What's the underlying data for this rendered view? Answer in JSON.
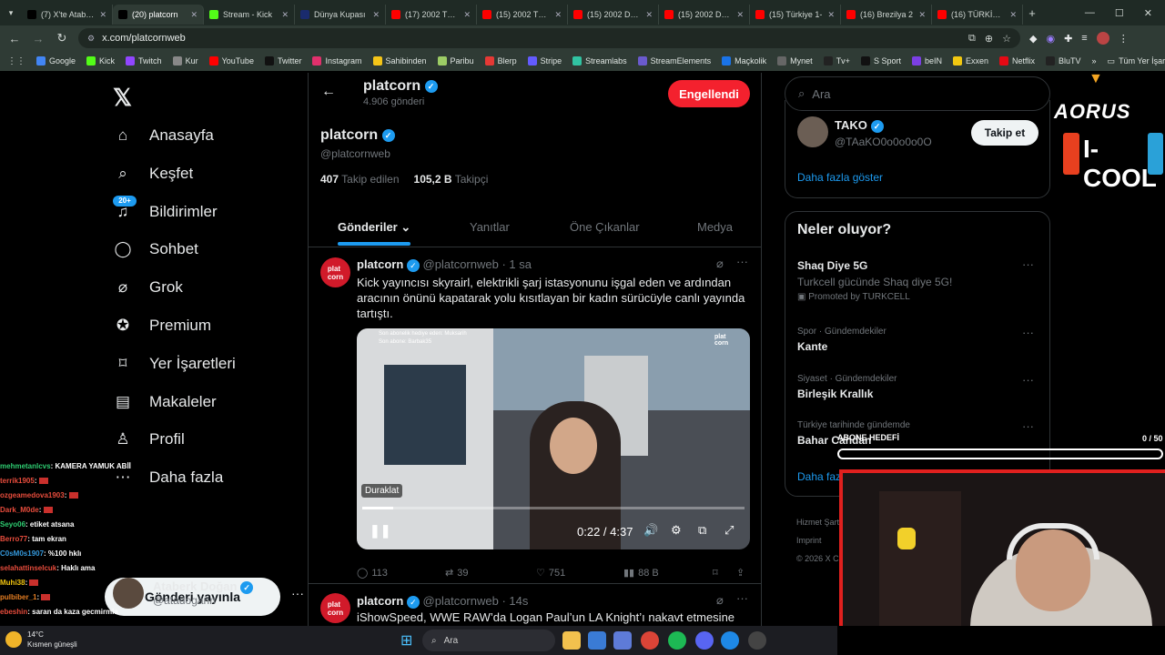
{
  "browser": {
    "tabs": [
      {
        "label": "(7) X'te Ataberk",
        "fav_color": "#000"
      },
      {
        "label": "(20) platcorn",
        "fav_color": "#000",
        "active": true
      },
      {
        "label": "Stream - Kick",
        "fav_color": "#53fc18"
      },
      {
        "label": "Dünya Kupası",
        "fav_color": "#1a2b6d"
      },
      {
        "label": "(17) 2002 TÜRK",
        "fav_color": "#ff0000"
      },
      {
        "label": "(15) 2002 TÜRK",
        "fav_color": "#ff0000"
      },
      {
        "label": "(15) 2002 Düny",
        "fav_color": "#ff0000"
      },
      {
        "label": "(15) 2002 DÜN",
        "fav_color": "#ff0000"
      },
      {
        "label": "(15) Türkiye 1-",
        "fav_color": "#ff0000"
      },
      {
        "label": "(16) Brezilya 2",
        "fav_color": "#ff0000"
      },
      {
        "label": "(16) TÜRKİYE 4",
        "fav_color": "#ff0000"
      }
    ],
    "url": "x.com/platcornweb",
    "bookmarks": [
      "Google",
      "Kick",
      "Twitch",
      "Kur",
      "YouTube",
      "Twitter",
      "Instagram",
      "Sahibinden",
      "Paribu",
      "Blerp",
      "Stripe",
      "Streamlabs",
      "StreamElements",
      "Maçkolik",
      "Mynet",
      "Tv+",
      "S Sport",
      "beIN",
      "Exxen",
      "Netflix",
      "BluTV"
    ],
    "bookmarks_all": "Tüm Yer İşaretleri"
  },
  "nav": {
    "items": [
      "Anasayfa",
      "Keşfet",
      "Bildirimler",
      "Sohbet",
      "Grok",
      "Premium",
      "Yer İşaretleri",
      "Makaleler",
      "Profil",
      "Daha fazla"
    ],
    "notif_badge": "20+",
    "post_button": "Gönderi yayınla",
    "account_name": "Ataberk Doğan",
    "account_handle": "@atadogann"
  },
  "profile": {
    "header_name": "platcorn",
    "header_posts": "4.906 gönderi",
    "blocked_button": "Engellendi",
    "name": "platcorn",
    "handle": "@platcornweb",
    "following_count": "407",
    "following_label": "Takip edilen",
    "followers_count": "105,2 B",
    "followers_label": "Takipçi",
    "tabs": [
      "Gönderiler",
      "Yanıtlar",
      "Öne Çıkanlar",
      "Medya"
    ]
  },
  "tweet1": {
    "name": "platcorn",
    "handle": "@platcornweb",
    "time": "· 1 sa",
    "text": "Kick yayıncısı skyrairl, elektrikli şarj istasyonunu işgal eden ve ardından aracının önünü kapatarak yolu kısıtlayan bir kadın sürücüyle canlı yayında tartıştı.",
    "video_pause_label": "Duraklat",
    "video_time": "0:22 / 4:37",
    "video_progress": 0.08,
    "video_overlay_1": "Son abonelik hediye eden: Muksarih",
    "video_overlay_2": "Son abone: Barbak35",
    "replies": "113",
    "reposts": "39",
    "likes": "751",
    "views": "88 B"
  },
  "tweet2": {
    "name": "platcorn",
    "handle": "@platcornweb",
    "time": "· 14s",
    "text": "iShowSpeed, WWE RAW’da Logan Paul’un LA Knight’ı nakavt etmesine"
  },
  "search": {
    "placeholder": "Ara"
  },
  "suggest": {
    "name": "TAKO",
    "handle": "@TAaKO0o0o0o0O",
    "follow_button": "Takip et",
    "more": "Daha fazla göster"
  },
  "trends": {
    "title": "Neler oluyor?",
    "items": [
      {
        "meta": "",
        "title": "Shaq Diye 5G",
        "sub": "Turkcell gücünde Shaq diye 5G!",
        "promo": "Promoted by TURKCELL"
      },
      {
        "meta": "Spor · Gündemdekiler",
        "title": "Kante"
      },
      {
        "meta": "Siyaset · Gündemdekiler",
        "title": "Birleşik Krallık"
      },
      {
        "meta": "Türkiye tarihinde gündemde",
        "title": "Bahar Candan"
      }
    ],
    "more": "Daha fazla göster"
  },
  "footer": {
    "line1": "Hizmet Şartları",
    "line2": "Imprint",
    "line3": "© 2026 X Corp."
  },
  "overlay": {
    "sub_goal_label": "ABONE HEDEFİ",
    "sub_goal_count": "0 / 50",
    "sub_goal_progress": 0,
    "sponsor1": "AORUS",
    "sponsor2": "I-COOL"
  },
  "chat": [
    {
      "user": "mehmetanlcvs",
      "user_color": "#2ecc71",
      "msg": ": KAMERA YAMUK ABİİ"
    },
    {
      "user": "terrik1905",
      "user_color": "#e74c3c",
      "msg": ":",
      "flag": true
    },
    {
      "user": "ozgeamedova1903",
      "user_color": "#e74c3c",
      "msg": ":",
      "flag": true
    },
    {
      "user": "Dark_M0de",
      "user_color": "#e74c3c",
      "msg": ":",
      "flag": true
    },
    {
      "user": "Seyo06",
      "user_color": "#2ecc71",
      "msg": ": etiket atsana"
    },
    {
      "user": "Berro77",
      "user_color": "#e74c3c",
      "msg": ": tam ekran"
    },
    {
      "user": "C0sM0s1907",
      "user_color": "#3498db",
      "msg": ": %100 hklı"
    },
    {
      "user": "selahattinselcuk",
      "user_color": "#e74c3c",
      "msg": ": Haklı ama"
    },
    {
      "user": "Muhi38",
      "user_color": "#f1c40f",
      "msg": ":",
      "flag": true
    },
    {
      "user": "pulbiber_1",
      "user_color": "#e67e22",
      "msg": ":",
      "flag": true
    },
    {
      "user": "ebeshin",
      "user_color": "#e74c3c",
      "msg": ": saran da kaza gecmirmia"
    }
  ],
  "weather": {
    "temp": "14°C",
    "desc": "Kısmen güneşli"
  },
  "taskbar": {
    "search": "Ara"
  }
}
